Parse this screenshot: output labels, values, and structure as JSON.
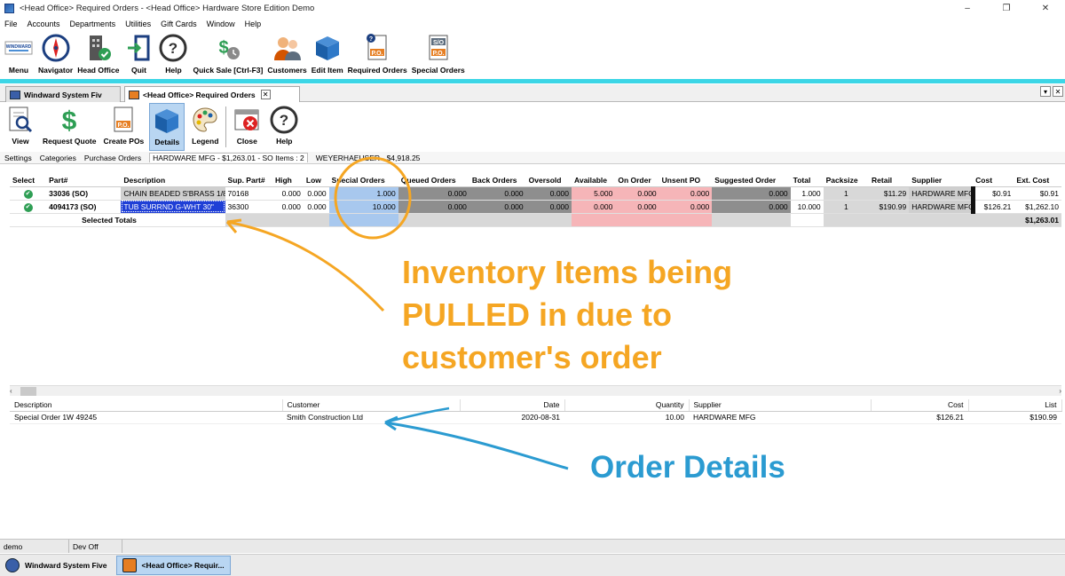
{
  "window": {
    "title": "<Head Office> Required Orders - <Head Office> Hardware Store Edition Demo",
    "min": "–",
    "max": "❐",
    "close": "✕"
  },
  "menu": [
    "File",
    "Accounts",
    "Departments",
    "Utilities",
    "Gift Cards",
    "Window",
    "Help"
  ],
  "toolbar": [
    {
      "label": "Menu",
      "icon": "windward-logo-icon"
    },
    {
      "label": "Navigator",
      "icon": "compass-icon"
    },
    {
      "label": "Head Office",
      "icon": "office-tower-icon"
    },
    {
      "label": "Quit",
      "icon": "exit-door-icon"
    },
    {
      "label": "Help",
      "icon": "help-icon"
    },
    {
      "label": "Quick Sale [Ctrl-F3]",
      "icon": "cash-icon"
    },
    {
      "label": "Customers",
      "icon": "customers-icon"
    },
    {
      "label": "Edit Item",
      "icon": "box-icon"
    },
    {
      "label": "Required Orders",
      "icon": "po-doc-icon"
    },
    {
      "label": "Special Orders",
      "icon": "so-doc-icon"
    }
  ],
  "tabs": [
    {
      "label": "Windward System Fiv"
    },
    {
      "label": "<Head Office> Required Orders"
    }
  ],
  "toolbar2": [
    {
      "label": "View",
      "icon": "view-doc-icon"
    },
    {
      "label": "Request Quote",
      "icon": "dollar-icon"
    },
    {
      "label": "Create POs",
      "icon": "po-doc-icon"
    },
    {
      "label": "Details",
      "icon": "box-icon"
    },
    {
      "label": "Legend",
      "icon": "palette-icon"
    },
    {
      "label": "Close",
      "icon": "close-window-icon"
    },
    {
      "label": "Help",
      "icon": "help-icon"
    }
  ],
  "subtabs": [
    "Settings",
    "Categories",
    "Purchase Orders",
    "HARDWARE MFG - $1,263.01 - SO Items : 2",
    "WEYERHAEUSER - $4,918.25"
  ],
  "grid": {
    "headers": [
      "Select",
      "Part#",
      "Description",
      "Sup. Part#",
      "High",
      "Low",
      "Special Orders",
      "Queued Orders",
      "Back Orders",
      "Oversold",
      "Available",
      "On Order",
      "Unsent PO",
      "Suggested Order",
      "Total",
      "Packsize",
      "Retail",
      "Supplier",
      "Cost",
      "Ext. Cost"
    ],
    "rows": [
      {
        "part": "33036 (SO)",
        "desc": "CHAIN BEADED S'BRASS 1/8",
        "sup": "70168",
        "high": "0.000",
        "low": "0.000",
        "so": "1.000",
        "qo": "0.000",
        "bo": "0.000",
        "ov": "0.000",
        "av": "5.000",
        "oo": "0.000",
        "up": "0.000",
        "sg": "0.000",
        "tot": "1.000",
        "pk": "1",
        "ret": "$11.29",
        "supp": "HARDWARE MFG",
        "cost": "$0.91",
        "ext": "$0.91"
      },
      {
        "part": "4094173 (SO)",
        "desc": "TUB SURRND G-WHT 30\"",
        "sup": "36300",
        "high": "0.000",
        "low": "0.000",
        "so": "10.000",
        "qo": "0.000",
        "bo": "0.000",
        "ov": "0.000",
        "av": "0.000",
        "oo": "0.000",
        "up": "0.000",
        "sg": "0.000",
        "tot": "10.000",
        "pk": "1",
        "ret": "$190.99",
        "supp": "HARDWARE MFG",
        "cost": "$126.21",
        "ext": "$1,262.10"
      }
    ],
    "totals_label": "Selected Totals",
    "totals_ext": "$1,263.01"
  },
  "detail": {
    "headers": [
      "Description",
      "Customer",
      "Date",
      "Quantity",
      "Supplier",
      "Cost",
      "List"
    ],
    "row": {
      "desc": "Special Order  1W 49245",
      "customer": "Smith Construction Ltd",
      "date": "2020-08-31",
      "qty": "10.00",
      "supplier": "HARDWARE MFG",
      "cost": "$126.21",
      "list": "$190.99"
    }
  },
  "annotations": {
    "orange_lines": [
      "Inventory Items being",
      "PULLED in due to",
      "customer's order"
    ],
    "blue": "Order Details",
    "orange_color": "#f5a623",
    "blue_color": "#2b9bd1"
  },
  "status": [
    "demo",
    "Dev Off"
  ],
  "taskbar": [
    "Windward System Five",
    "<Head Office> Requir..."
  ]
}
